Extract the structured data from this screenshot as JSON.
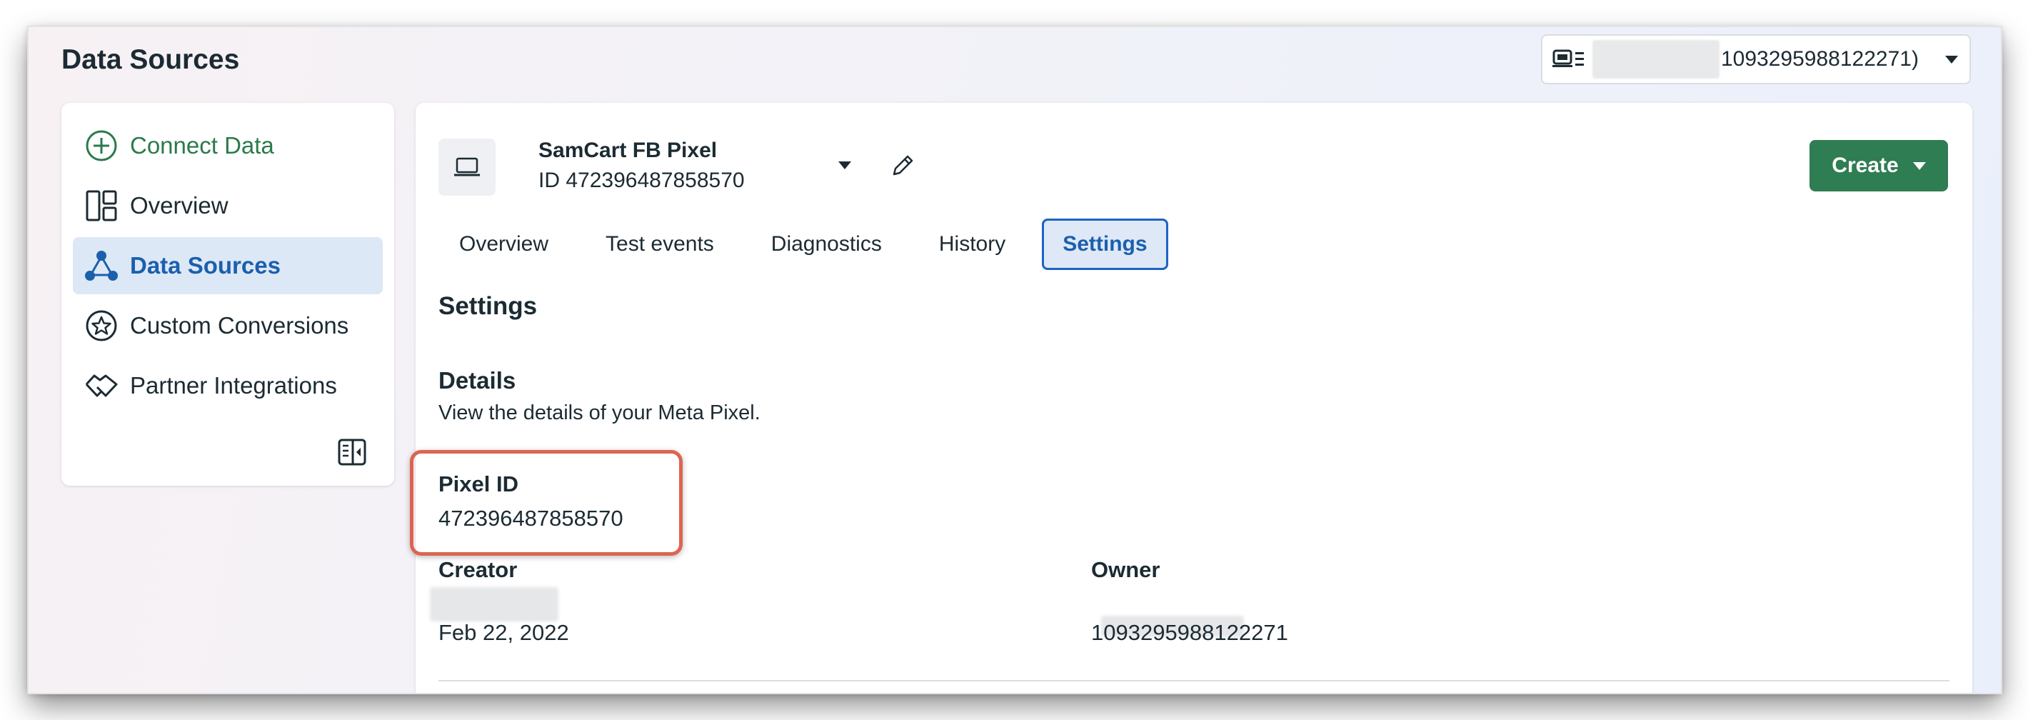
{
  "page": {
    "title": "Data Sources"
  },
  "account": {
    "id_text": "1093295988122271)"
  },
  "sidebar": {
    "items": [
      {
        "label": "Connect Data",
        "icon": "plus-circle-icon"
      },
      {
        "label": "Overview",
        "icon": "layout-grid-icon"
      },
      {
        "label": "Data Sources",
        "icon": "network-icon",
        "active": true
      },
      {
        "label": "Custom Conversions",
        "icon": "star-circle-icon"
      },
      {
        "label": "Partner Integrations",
        "icon": "handshake-icon"
      }
    ]
  },
  "pixel": {
    "name": "SamCart FB Pixel",
    "id_line": "ID 472396487858570"
  },
  "toolbar": {
    "create_label": "Create"
  },
  "tabs": [
    {
      "label": "Overview"
    },
    {
      "label": "Test events"
    },
    {
      "label": "Diagnostics"
    },
    {
      "label": "History"
    },
    {
      "label": "Settings",
      "active": true
    }
  ],
  "settings": {
    "title": "Settings",
    "details_title": "Details",
    "details_desc": "View the details of your Meta Pixel.",
    "pixel_id_label": "Pixel ID",
    "pixel_id_value": "472396487858570",
    "creator_label": "Creator",
    "creator_date": "Feb 22, 2022",
    "owner_label": "Owner",
    "owner_id": "1093295988122271"
  },
  "colors": {
    "accent_green": "#2f7d52",
    "active_blue": "#1b5fae",
    "highlight_red": "#dc6552"
  }
}
